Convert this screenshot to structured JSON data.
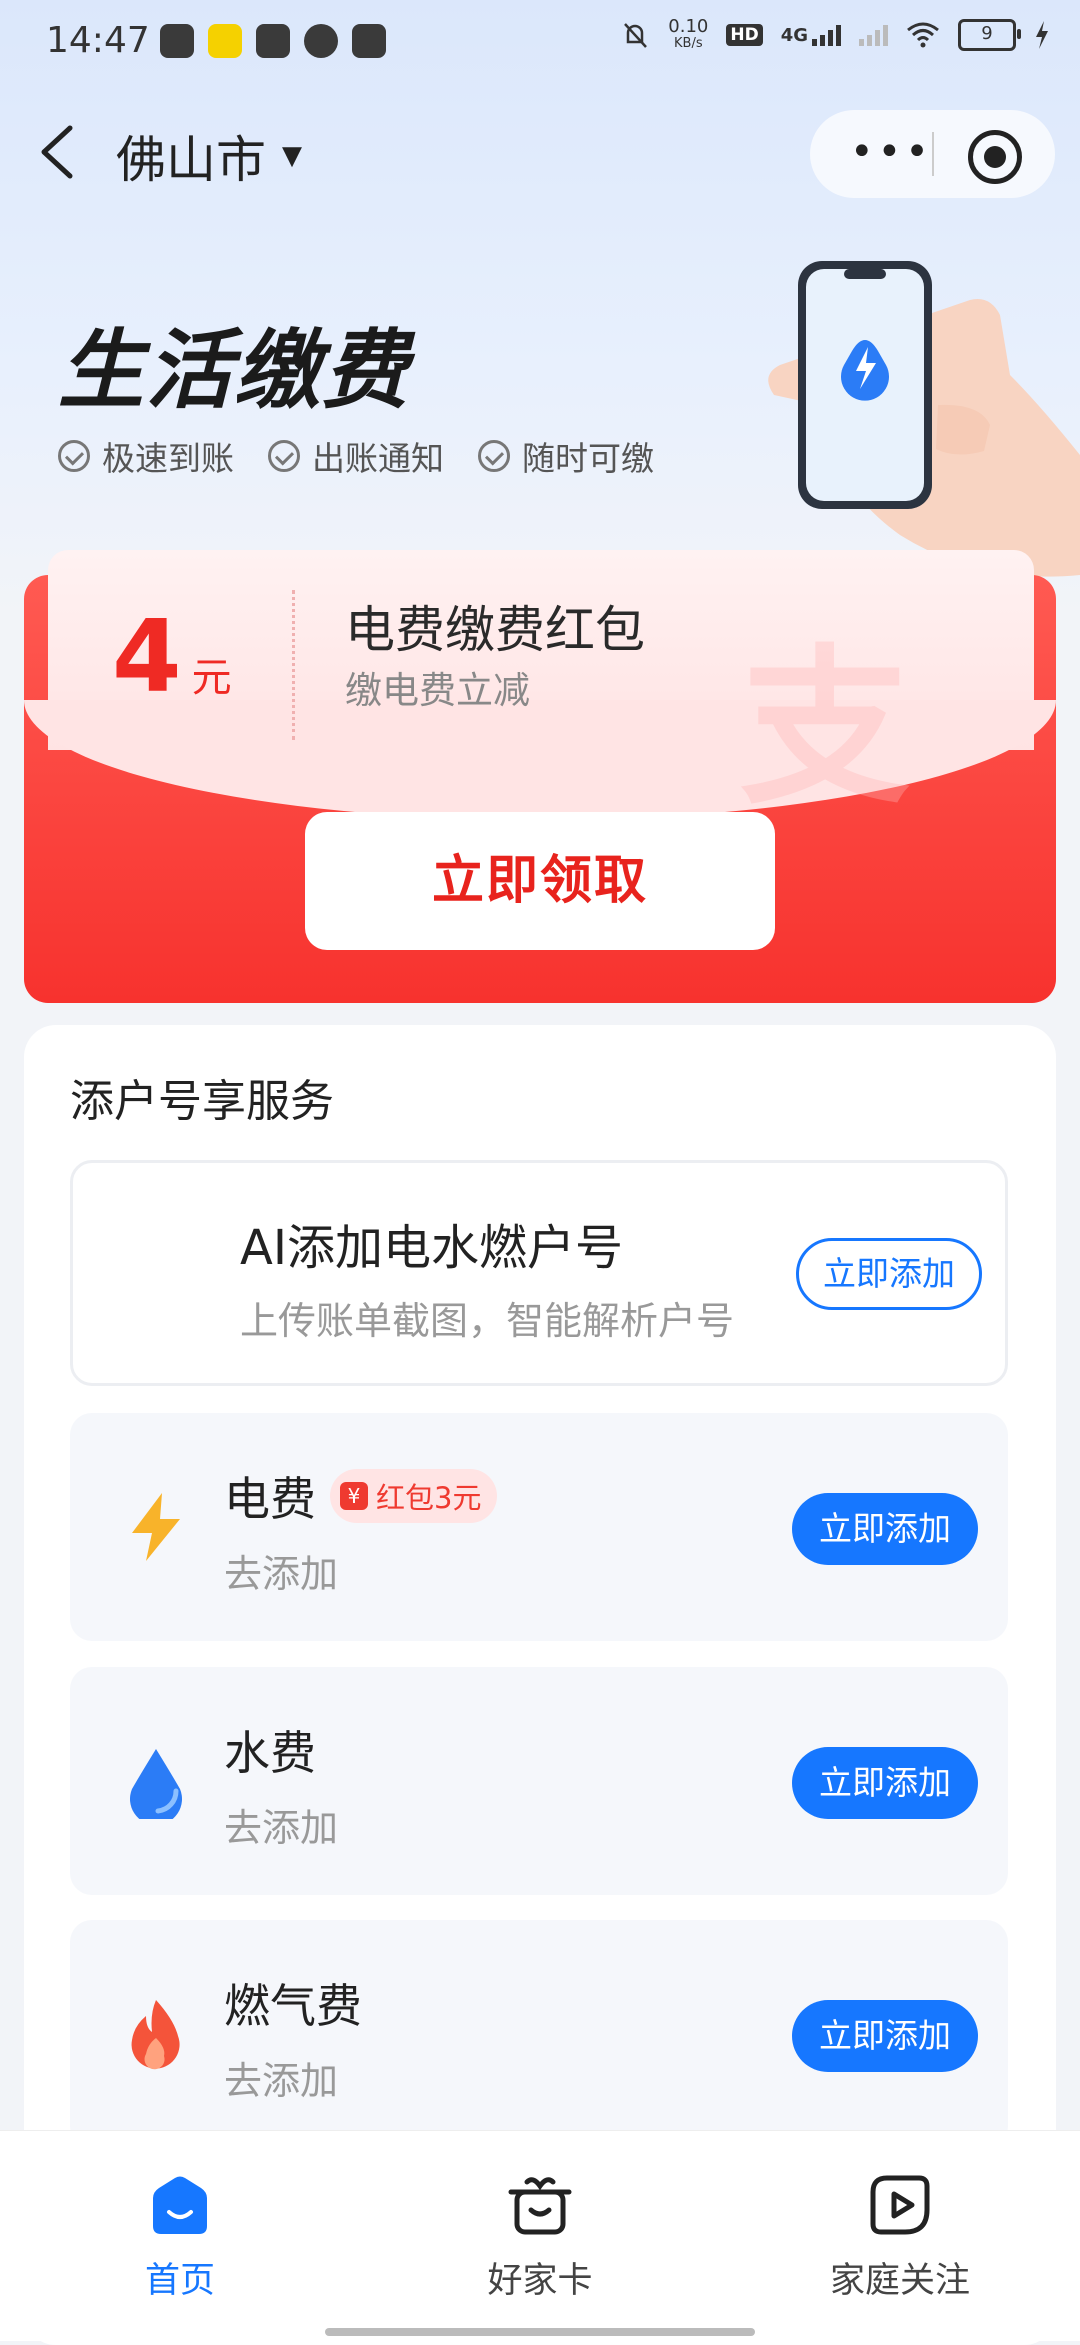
{
  "status_bar": {
    "time": "14:47",
    "net_speed": "0.10",
    "net_unit": "KB/s",
    "hd": "HD",
    "network": "4G",
    "battery": "9"
  },
  "nav": {
    "city": "佛山市"
  },
  "hero": {
    "title": "生活缴费",
    "features": [
      "极速到账",
      "出账通知",
      "随时可缴"
    ]
  },
  "coupon": {
    "amount": "4",
    "unit": "元",
    "title": "电费缴费红包",
    "subtitle": "缴电费立减",
    "claim_label": "立即领取"
  },
  "services": {
    "title": "添户号享服务",
    "ai": {
      "title": "AI添加电水燃户号",
      "subtitle": "上传账单截图，智能解析户号",
      "button": "立即添加"
    },
    "items": [
      {
        "name": "电费",
        "badge": "红包3元",
        "badge_icon": "¥",
        "sub": "去添加",
        "button": "立即添加",
        "icon": "lightning-icon",
        "color": "#f8b32a"
      },
      {
        "name": "水费",
        "sub": "去添加",
        "button": "立即添加",
        "icon": "water-drop-icon",
        "color": "#2b7cf6"
      },
      {
        "name": "燃气费",
        "sub": "去添加",
        "button": "立即添加",
        "icon": "flame-icon",
        "color": "#f4543a"
      }
    ]
  },
  "tabbar": {
    "items": [
      {
        "label": "首页",
        "active": true
      },
      {
        "label": "好家卡",
        "active": false
      },
      {
        "label": "家庭关注",
        "active": false
      }
    ]
  },
  "colors": {
    "primary": "#1677ff",
    "red": "#f7322e",
    "coupon_text": "#ef2a24"
  }
}
